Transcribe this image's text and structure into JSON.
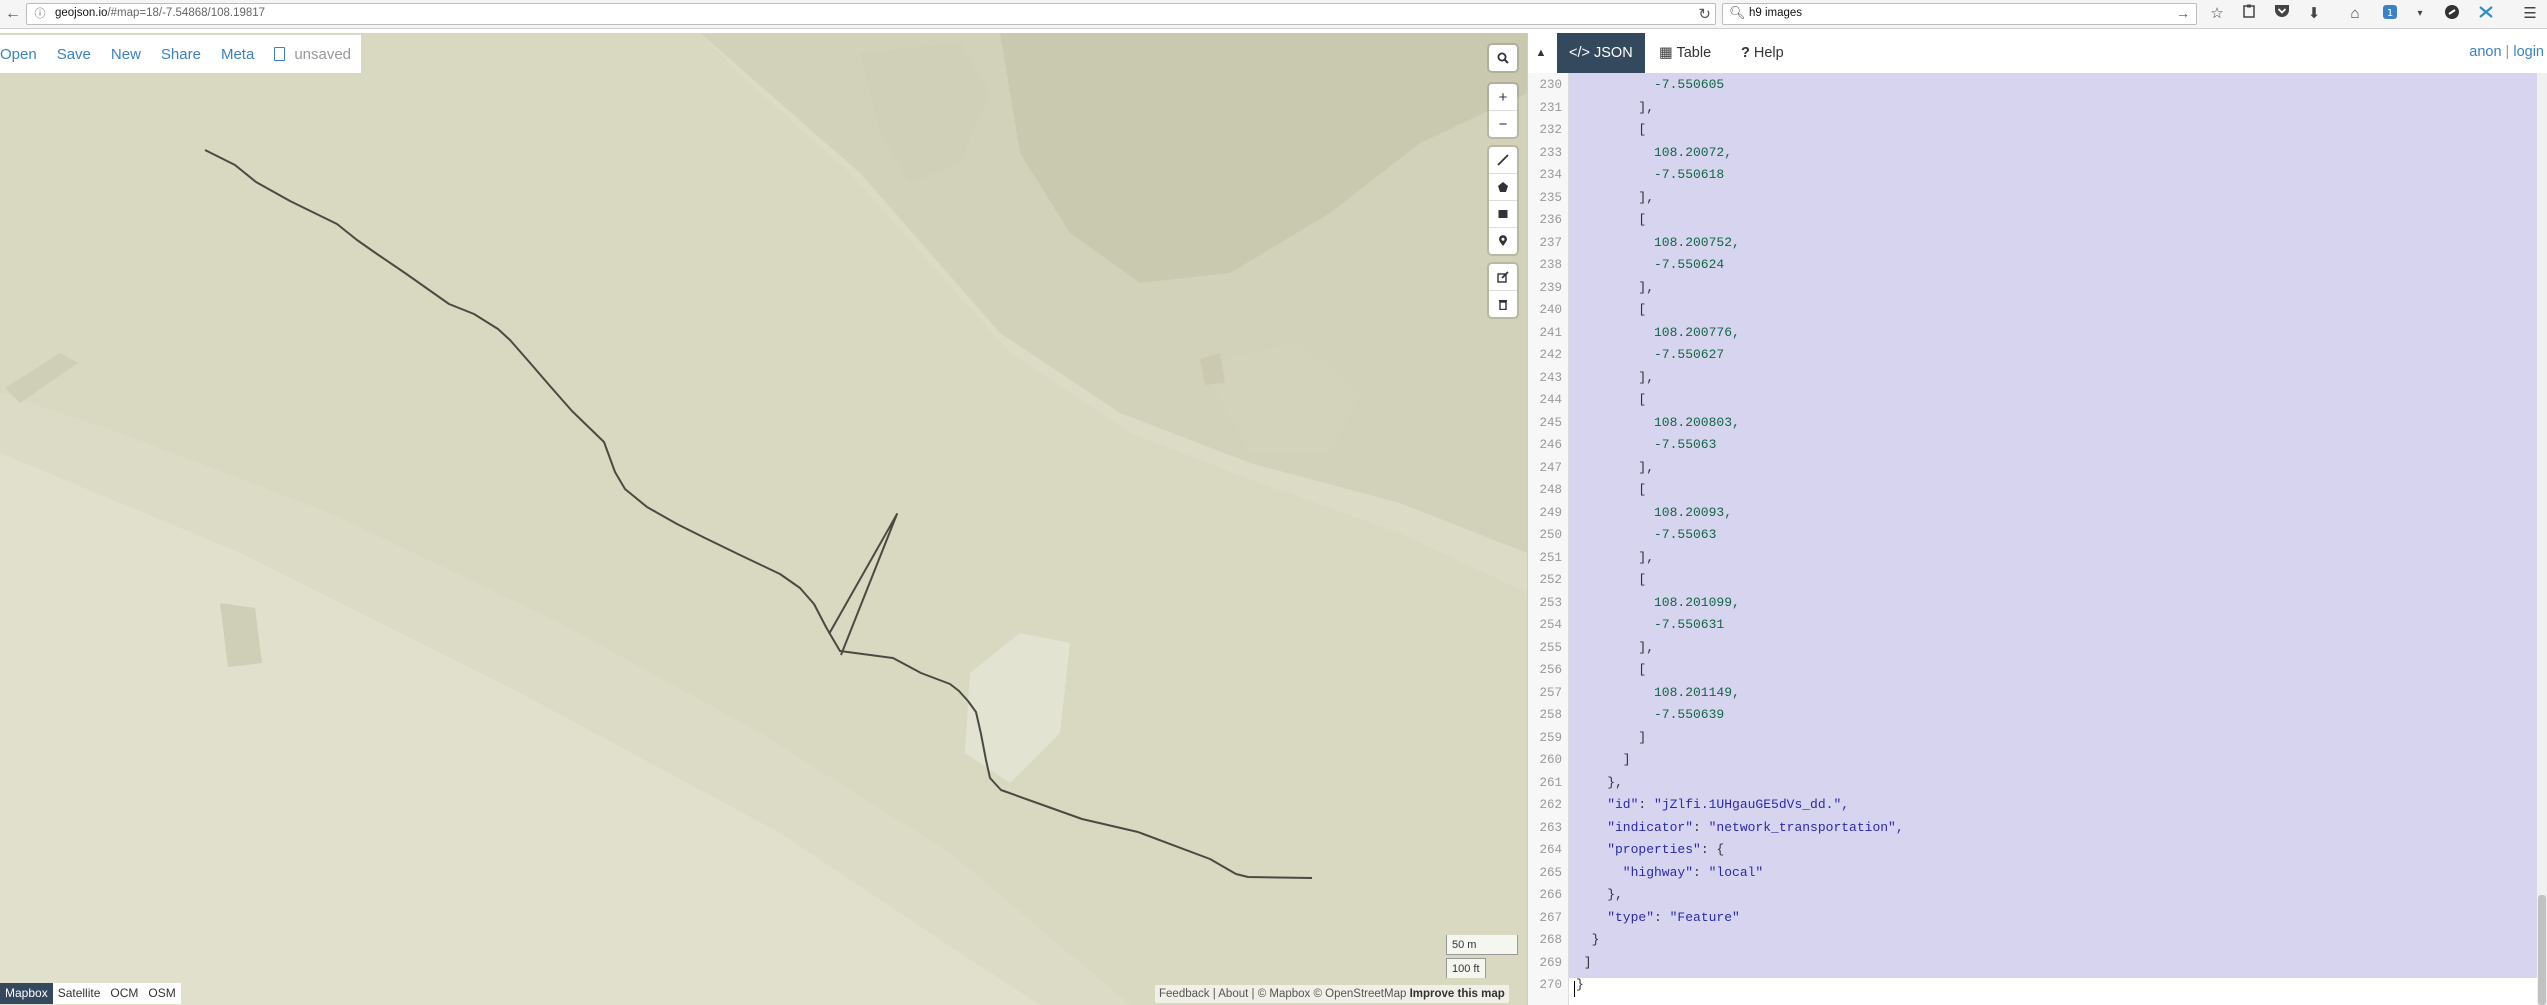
{
  "browser": {
    "url": "geojson.io/#map=18/-7.54868/108.19817",
    "url_host": "geojson.io",
    "url_path": "/#map=18/-7.54868/108.19817",
    "search_text": "h9 images",
    "toolbar_icons": [
      "star-icon",
      "clipboard-icon",
      "pocket-icon",
      "download-icon",
      "home-icon",
      "extension-icon",
      "chevron-down-icon",
      "extension-round-icon",
      "extension-puzzle-icon",
      "menu-icon"
    ]
  },
  "map": {
    "menu": [
      "Open",
      "Save",
      "New",
      "Share",
      "Meta"
    ],
    "unsaved": "unsaved",
    "scale_metric": "50 m",
    "scale_imperial": "100 ft",
    "layers": [
      "Mapbox",
      "Satellite",
      "OCM",
      "OSM"
    ],
    "active_layer": "Mapbox",
    "attribution": {
      "feedback": "Feedback",
      "sep1": " | ",
      "about": "About",
      "sep2": " | © ",
      "mapbox": "Mapbox",
      "sep3": " © ",
      "osm": "OpenStreetMap",
      "improve": "Improve this map"
    },
    "line_color": "#4a4a42",
    "land_color": "#dcdcc6"
  },
  "panel": {
    "tabs": [
      {
        "label": "JSON",
        "icon": "code-icon",
        "active": true
      },
      {
        "label": "Table",
        "icon": "table-icon",
        "active": false
      },
      {
        "label": "Help",
        "icon": "question-icon",
        "active": false
      }
    ],
    "auth": {
      "anon": "anon",
      "sep": " | ",
      "login": "login"
    },
    "editor_lines": [
      {
        "n": "230",
        "indent": 10,
        "text": "-7.550605",
        "kind": "num"
      },
      {
        "n": "231",
        "indent": 8,
        "text": "],",
        "kind": "pun"
      },
      {
        "n": "232",
        "indent": 8,
        "text": "[",
        "kind": "pun"
      },
      {
        "n": "233",
        "indent": 10,
        "text": "108.20072,",
        "kind": "num"
      },
      {
        "n": "234",
        "indent": 10,
        "text": "-7.550618",
        "kind": "num"
      },
      {
        "n": "235",
        "indent": 8,
        "text": "],",
        "kind": "pun"
      },
      {
        "n": "236",
        "indent": 8,
        "text": "[",
        "kind": "pun"
      },
      {
        "n": "237",
        "indent": 10,
        "text": "108.200752,",
        "kind": "num"
      },
      {
        "n": "238",
        "indent": 10,
        "text": "-7.550624",
        "kind": "num"
      },
      {
        "n": "239",
        "indent": 8,
        "text": "],",
        "kind": "pun"
      },
      {
        "n": "240",
        "indent": 8,
        "text": "[",
        "kind": "pun"
      },
      {
        "n": "241",
        "indent": 10,
        "text": "108.200776,",
        "kind": "num"
      },
      {
        "n": "242",
        "indent": 10,
        "text": "-7.550627",
        "kind": "num"
      },
      {
        "n": "243",
        "indent": 8,
        "text": "],",
        "kind": "pun"
      },
      {
        "n": "244",
        "indent": 8,
        "text": "[",
        "kind": "pun"
      },
      {
        "n": "245",
        "indent": 10,
        "text": "108.200803,",
        "kind": "num"
      },
      {
        "n": "246",
        "indent": 10,
        "text": "-7.55063",
        "kind": "num"
      },
      {
        "n": "247",
        "indent": 8,
        "text": "],",
        "kind": "pun"
      },
      {
        "n": "248",
        "indent": 8,
        "text": "[",
        "kind": "pun"
      },
      {
        "n": "249",
        "indent": 10,
        "text": "108.20093,",
        "kind": "num"
      },
      {
        "n": "250",
        "indent": 10,
        "text": "-7.55063",
        "kind": "num"
      },
      {
        "n": "251",
        "indent": 8,
        "text": "],",
        "kind": "pun"
      },
      {
        "n": "252",
        "indent": 8,
        "text": "[",
        "kind": "pun"
      },
      {
        "n": "253",
        "indent": 10,
        "text": "108.201099,",
        "kind": "num"
      },
      {
        "n": "254",
        "indent": 10,
        "text": "-7.550631",
        "kind": "num"
      },
      {
        "n": "255",
        "indent": 8,
        "text": "],",
        "kind": "pun"
      },
      {
        "n": "256",
        "indent": 8,
        "text": "[",
        "kind": "pun"
      },
      {
        "n": "257",
        "indent": 10,
        "text": "108.201149,",
        "kind": "num"
      },
      {
        "n": "258",
        "indent": 10,
        "text": "-7.550639",
        "kind": "num"
      },
      {
        "n": "259",
        "indent": 8,
        "text": "]",
        "kind": "pun"
      },
      {
        "n": "260",
        "indent": 6,
        "text": "]",
        "kind": "pun"
      },
      {
        "n": "261",
        "indent": 4,
        "text": "},",
        "kind": "pun"
      },
      {
        "n": "262",
        "indent": 4,
        "key": "\"id\"",
        "text": "\"jZlfi.1UHgauGE5dVs_dd.\",",
        "kind": "kv"
      },
      {
        "n": "263",
        "indent": 4,
        "key": "\"indicator\"",
        "text": "\"network_transportation\",",
        "kind": "kv"
      },
      {
        "n": "264",
        "indent": 4,
        "key": "\"properties\"",
        "text": "{",
        "kind": "kvp"
      },
      {
        "n": "265",
        "indent": 6,
        "key": "\"highway\"",
        "text": "\"local\"",
        "kind": "kv"
      },
      {
        "n": "266",
        "indent": 4,
        "text": "},",
        "kind": "pun"
      },
      {
        "n": "267",
        "indent": 4,
        "key": "\"type\"",
        "text": "\"Feature\"",
        "kind": "kv"
      },
      {
        "n": "268",
        "indent": 2,
        "text": "}",
        "kind": "pun"
      },
      {
        "n": "269",
        "indent": 1,
        "text": "]",
        "kind": "pun"
      },
      {
        "n": "270",
        "indent": 0,
        "text": "}",
        "kind": "pun"
      }
    ]
  }
}
